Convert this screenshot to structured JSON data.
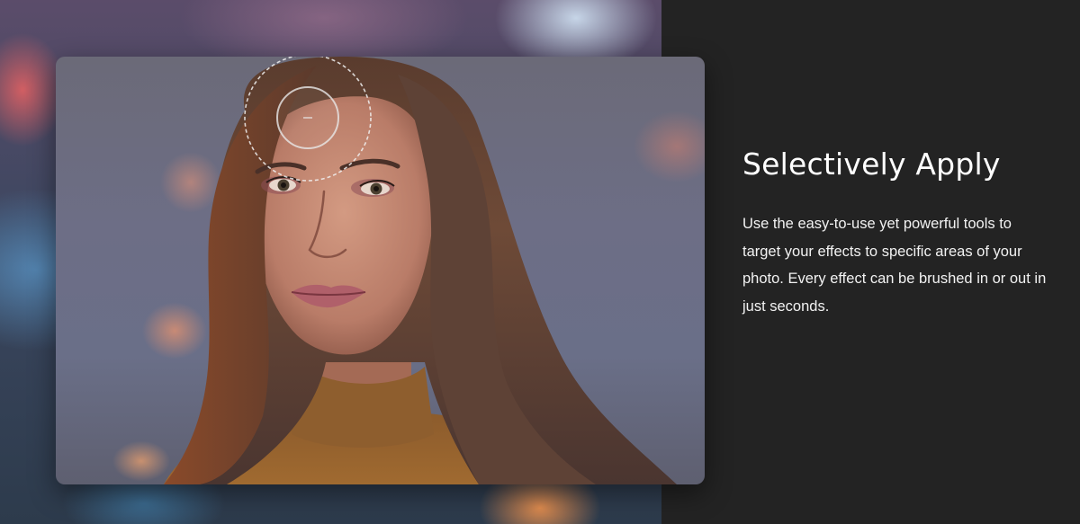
{
  "feature": {
    "heading": "Selectively Apply",
    "description": "Use the easy-to-use yet powerful tools to target your effects to specific areas of your photo. Every effect can be brushed in or out in just seconds."
  },
  "colors": {
    "page_background": "#232323",
    "heading_color": "#ffffff",
    "text_color": "#f2f2f2"
  },
  "icons": {
    "brush_cursor": "brush-cursor-icon"
  }
}
